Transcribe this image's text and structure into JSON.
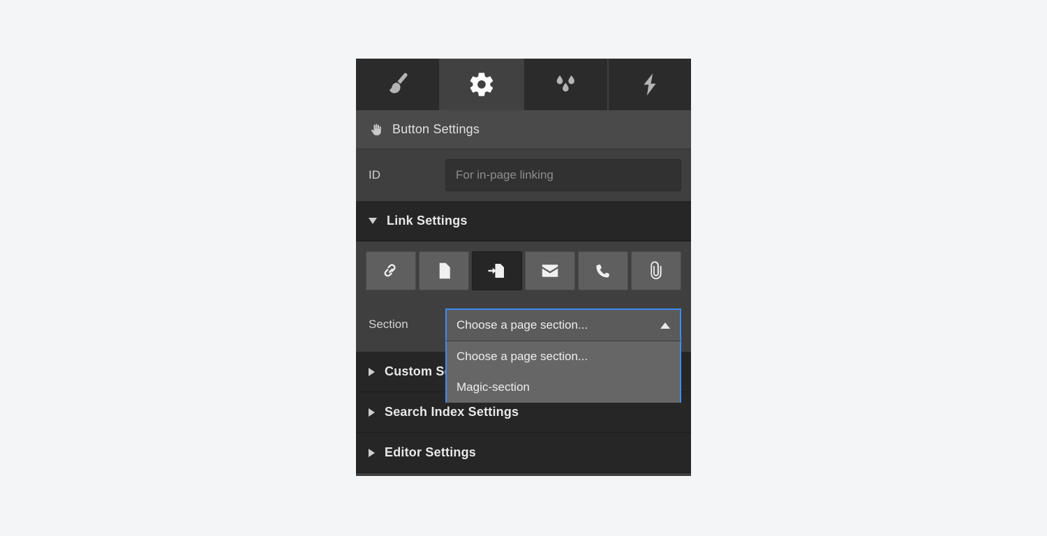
{
  "tabs": [
    {
      "name": "tab-style",
      "icon": "paintbrush-icon",
      "label": "Style",
      "active": false
    },
    {
      "name": "tab-settings",
      "icon": "gear-icon",
      "label": "Settings",
      "active": true
    },
    {
      "name": "tab-effects",
      "icon": "droplets-icon",
      "label": "Effects",
      "active": false
    },
    {
      "name": "tab-actions",
      "icon": "lightning-bolt-icon",
      "label": "Actions",
      "active": false
    }
  ],
  "panel": {
    "icon": "hand-pointer-icon",
    "title": "Button Settings"
  },
  "id_field": {
    "label": "ID",
    "value": "",
    "placeholder": "For in-page linking"
  },
  "link_settings": {
    "header_label": "Link Settings",
    "expanded": true,
    "link_types": [
      {
        "name": "link-type-url",
        "icon": "chain-link-icon",
        "label": "URL",
        "active": false
      },
      {
        "name": "link-type-page",
        "icon": "page-icon",
        "label": "Page",
        "active": false
      },
      {
        "name": "link-type-section",
        "icon": "anchor-section-icon",
        "label": "Section",
        "active": true
      },
      {
        "name": "link-type-email",
        "icon": "envelope-icon",
        "label": "Email",
        "active": false
      },
      {
        "name": "link-type-phone",
        "icon": "phone-icon",
        "label": "Phone",
        "active": false
      },
      {
        "name": "link-type-file",
        "icon": "paperclip-icon",
        "label": "File",
        "active": false
      }
    ],
    "section_select": {
      "label": "Section",
      "selected": "Choose a page section...",
      "open": true,
      "options": [
        "Choose a page section...",
        "Magic-section"
      ]
    }
  },
  "other_sections": [
    {
      "name": "section-custom-settings",
      "label": "Custom Settings",
      "expanded": false
    },
    {
      "name": "section-search-index-settings",
      "label": "Search Index Settings",
      "expanded": false
    },
    {
      "name": "section-editor-settings",
      "label": "Editor Settings",
      "expanded": false
    }
  ],
  "colors": {
    "page_background": "#f4f5f7",
    "panel_background": "#3f3f3f",
    "tab_inactive": "#2b2b2b",
    "tab_active": "#414141",
    "title_bar": "#4a4a4a",
    "section_header": "#262626",
    "select_focus_border": "#3d8bf2",
    "select_menu": "#666666",
    "button_idle": "#5f5f5f",
    "button_active": "#262626"
  }
}
